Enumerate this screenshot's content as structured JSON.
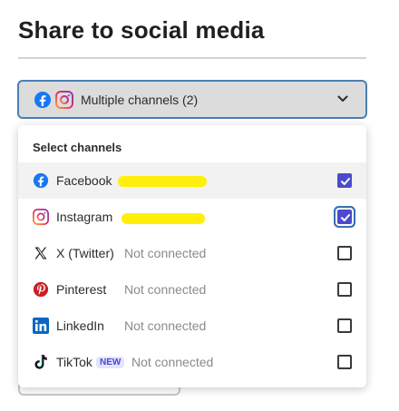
{
  "page": {
    "title": "Share to social media"
  },
  "picker": {
    "label": "Multiple channels (2)"
  },
  "popover": {
    "heading": "Select channels",
    "channels": [
      {
        "name": "Facebook",
        "status": "",
        "checked": true,
        "icon": "facebook-icon"
      },
      {
        "name": "Instagram",
        "status": "",
        "checked": true,
        "icon": "instagram-icon"
      },
      {
        "name": "X (Twitter)",
        "status": "Not connected",
        "checked": false,
        "icon": "x-twitter-icon"
      },
      {
        "name": "Pinterest",
        "status": "Not connected",
        "checked": false,
        "icon": "pinterest-icon"
      },
      {
        "name": "LinkedIn",
        "status": "Not connected",
        "checked": false,
        "icon": "linkedin-icon"
      },
      {
        "name": "TikTok",
        "status": "Not connected",
        "checked": false,
        "icon": "tiktok-icon",
        "badge": "NEW"
      }
    ]
  },
  "colors": {
    "accent": "#4b4bcb",
    "focus_ring": "#3a6fb0",
    "redaction": "#ffef0a"
  }
}
